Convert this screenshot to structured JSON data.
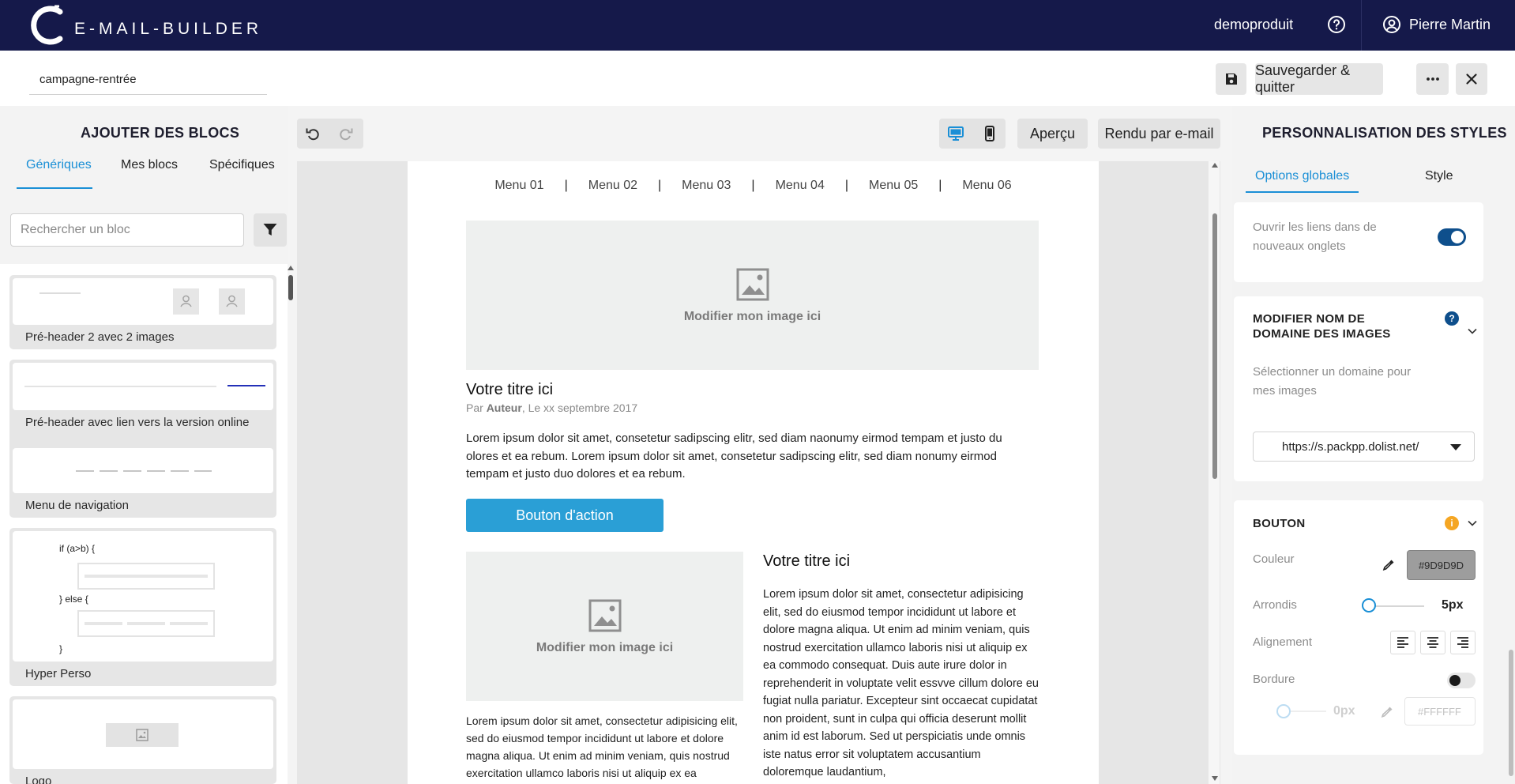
{
  "app": {
    "logo_text": "E-MAIL-BUILDER",
    "account": "demoproduit",
    "user_name": "Pierre Martin"
  },
  "campaign": {
    "name": "campagne-rentrée"
  },
  "actions": {
    "save_quit": "Sauvegarder & quitter"
  },
  "left_panel": {
    "title": "AJOUTER DES BLOCS",
    "tabs": [
      "Génériques",
      "Mes blocs",
      "Spécifiques"
    ],
    "active_tab": 0,
    "search_placeholder": "Rechercher un bloc",
    "blocks": [
      {
        "label": "Pré-header 2 avec 2 images"
      },
      {
        "label": "Pré-header avec lien vers la version online"
      },
      {
        "label": "Menu de navigation"
      },
      {
        "label": "Hyper Perso",
        "code_if": "if (a>b) {",
        "code_else": "} else {",
        "code_end": "}"
      },
      {
        "label": "Logo"
      }
    ]
  },
  "toolbar": {
    "preview": "Aperçu",
    "email_render": "Rendu par e-mail"
  },
  "email": {
    "menu": [
      "Menu 01",
      "Menu 02",
      "Menu 03",
      "Menu 04",
      "Menu 05",
      "Menu 06"
    ],
    "menu_separator": "|",
    "image_placeholder": "Modifier mon image ici",
    "title1": "Votre titre ici",
    "meta_prefix": "Par ",
    "meta_author": "Auteur",
    "meta_suffix": ", Le xx septembre 2017",
    "paragraph1": "Lorem ipsum dolor sit amet, consetetur sadipscing elitr, sed diam naonumy eirmod tempam et justo du olores et ea rebum. Lorem ipsum dolor sit amet, consetetur sadipscing elitr, sed diam nonumy eirmod tempam et justo duo dolores et ea rebum.",
    "cta_label": "Bouton d'action",
    "title2": "Votre titre ici",
    "paragraph2": "Lorem ipsum dolor sit amet, consectetur adipisicing elit, sed do eiusmod tempor incididunt ut labore et dolore magna aliqua. Ut enim ad minim veniam, quis nostrud exercitation ullamco laboris nisi ut aliquip ex ea commodo consequat. Duis aute irure dolor in reprehenderit in voluptate velit essvve cillum dolore eu fugiat nulla pariatur. Excepteur sint occaecat cupidatat non proident, sunt in culpa qui officia deserunt mollit anim id est laborum. Sed ut perspiciatis unde omnis iste natus error sit voluptatem accusantium doloremque laudantium,",
    "paragraph3": "Lorem ipsum dolor sit amet, consectetur adipisicing elit, sed do eiusmod tempor incididunt ut labore et dolore magna aliqua. Ut enim ad minim veniam, quis nostrud exercitation ullamco laboris nisi ut aliquip ex ea"
  },
  "right_panel": {
    "title": "PERSONNALISATION DES STYLES",
    "tabs": [
      "Options globales",
      "Style"
    ],
    "active_tab": 0,
    "open_links_label": "Ouvrir les liens dans de nouveaux onglets",
    "open_links_enabled": true,
    "domain_section_title": "MODIFIER NOM DE DOMAINE DES IMAGES",
    "domain_help_icon": "?",
    "domain_desc": "Sélectionner un domaine pour mes images",
    "domain_value": "https://s.packpp.dolist.net/",
    "button_section_title": "BOUTON",
    "button_info_icon": "i",
    "color_label": "Couleur",
    "color_value": "#9D9D9D",
    "radius_label": "Arrondis",
    "radius_value": "5px",
    "radius_fraction": 0,
    "alignment_label": "Alignement",
    "border_label": "Bordure",
    "border_enabled": false,
    "border_value": "0px",
    "border_color": "#FFFFFF"
  },
  "colors": {
    "topbar": "#15194a",
    "accent": "#1a8fd6",
    "cta": "#2a9fd6",
    "toggle_on": "#0e4f8c",
    "info_badge": "#f5a623"
  }
}
